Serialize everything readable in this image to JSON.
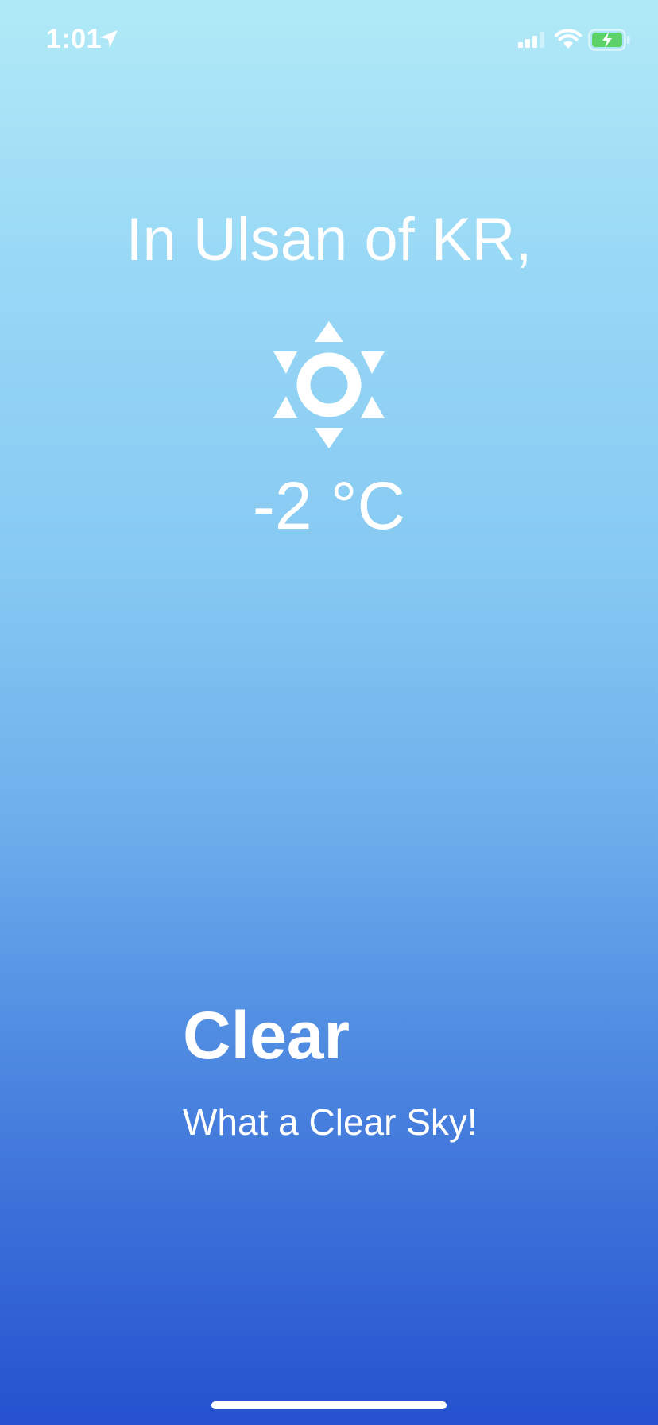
{
  "status_bar": {
    "time": "1:01",
    "icons": [
      "location-arrow-icon",
      "signal-icon",
      "wifi-icon",
      "battery-charging-icon"
    ],
    "battery_color": "#5dd26a"
  },
  "weather": {
    "location_title": "In Ulsan of KR,",
    "icon": "sun-icon",
    "temperature": "-2 °C",
    "condition": "Clear",
    "message": "What a Clear Sky!"
  },
  "colors": {
    "gradient_top": "#b1eaf7",
    "gradient_bottom": "#2551cf",
    "text": "#ffffff"
  }
}
